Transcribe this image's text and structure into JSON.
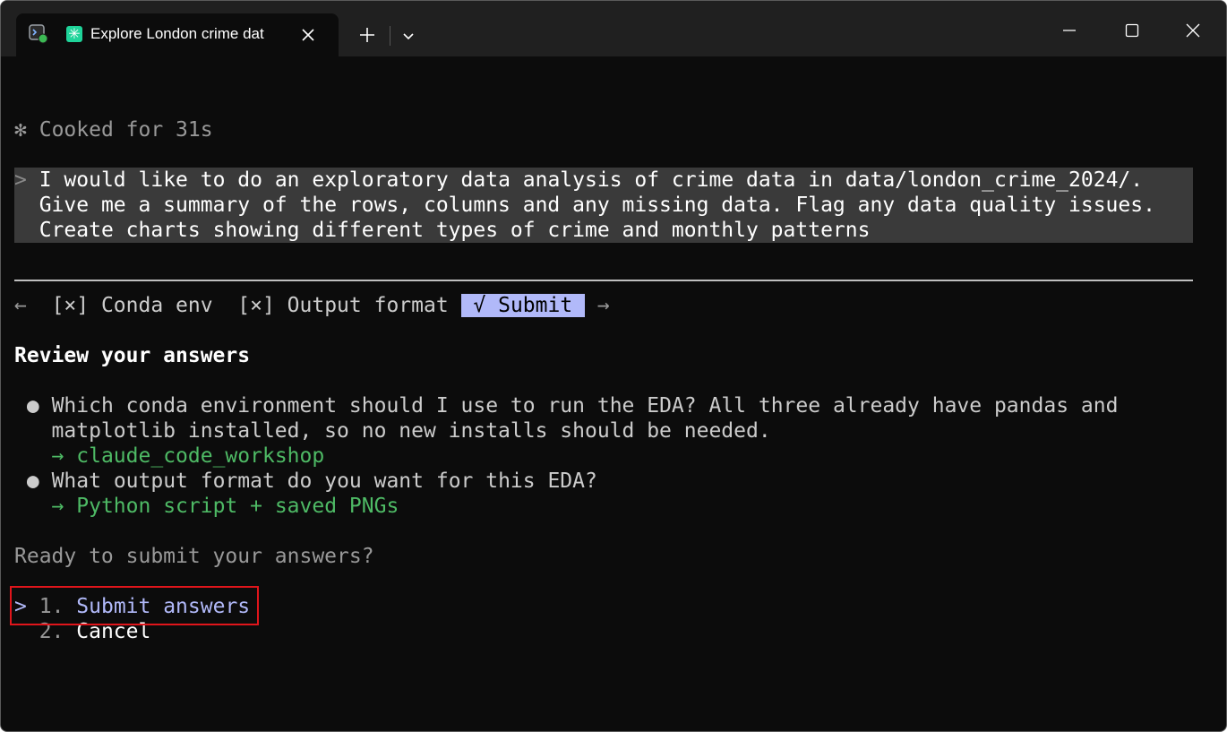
{
  "window": {
    "tab_title": "Explore London crime dat",
    "icons": {
      "app": "terminal-app-icon",
      "claude": "claude-asterisk-icon",
      "claude_glyph": "✳",
      "close_tab": "close-icon",
      "new_tab": "plus-icon",
      "dropdown": "chevron-down-icon",
      "minimize": "minimize-icon",
      "maximize": "maximize-icon",
      "close": "close-icon"
    },
    "colors": {
      "titlebar": "#202020",
      "terminal_bg": "#0c0c0c",
      "claude_green": "#1fd49a"
    }
  },
  "terminal": {
    "status": {
      "spinner": "✻",
      "text": "Cooked for 31s"
    },
    "prompt": {
      "marker": ">",
      "lines": [
        "I would like to do an exploratory data analysis of crime data in data/london_crime_2024/.",
        "Give me a summary of the rows, columns and any missing data. Flag any data quality issues.",
        "Create charts showing different types of crime and monthly patterns"
      ]
    },
    "nav": {
      "prev_arrow": "←",
      "steps": [
        {
          "label": "[×] Conda env"
        },
        {
          "label": "[×] Output format"
        },
        {
          "label": "√ Submit"
        }
      ],
      "next_arrow": "→"
    },
    "review": {
      "heading": "Review your answers",
      "bullet": "●",
      "answer_arrow": "→",
      "questions": [
        {
          "lines": [
            "Which conda environment should I use to run the EDA? All three already have pandas and",
            "matplotlib installed, so no new installs should be needed."
          ],
          "answer": "claude_code_workshop"
        },
        {
          "lines": [
            "What output format do you want for this EDA?"
          ],
          "answer": "Python script + saved PNGs"
        }
      ]
    },
    "confirm": {
      "question": "Ready to submit your answers?",
      "cursor": ">",
      "options": [
        {
          "number": "1.",
          "label": "Submit answers"
        },
        {
          "number": "2.",
          "label": "Cancel"
        }
      ]
    },
    "colors": {
      "accent": "#b1b9f9",
      "answer_green": "#4eba65",
      "highlight_red": "#e0151b"
    }
  }
}
